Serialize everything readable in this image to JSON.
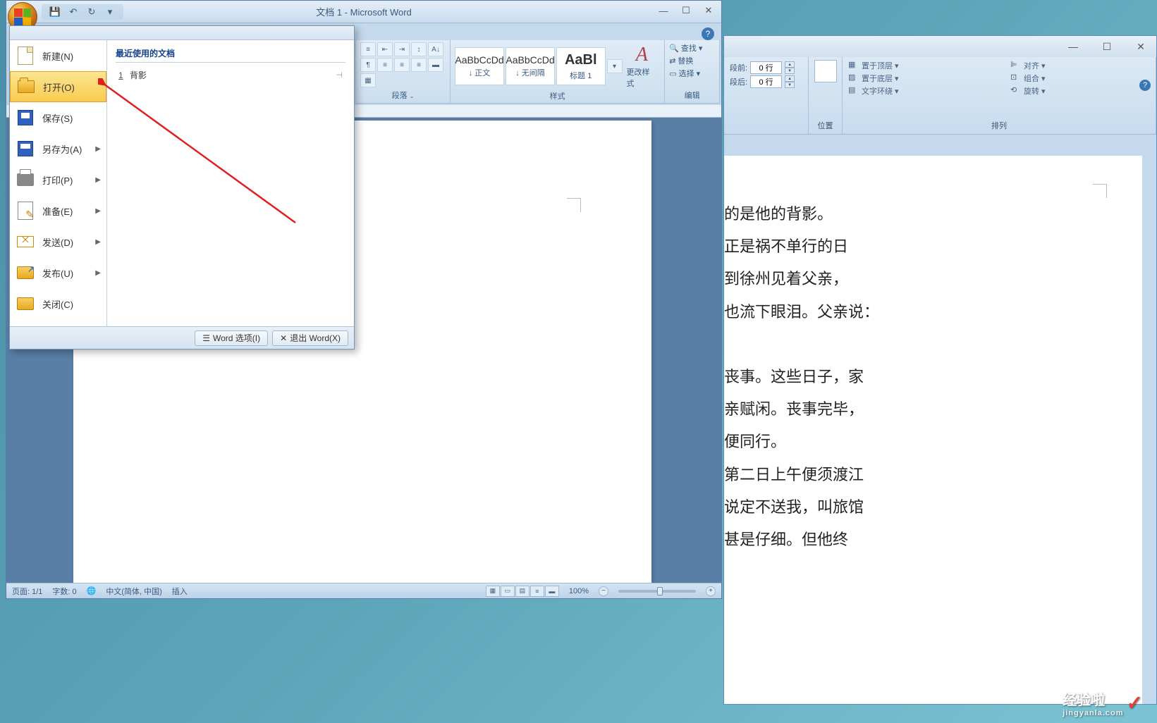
{
  "front_window": {
    "title": "文档 1 - Microsoft Word",
    "qat": {
      "save": "💾",
      "undo": "↶",
      "redo": "↻",
      "more": "▾"
    },
    "win": {
      "min": "—",
      "max": "☐",
      "close": "✕"
    },
    "help": "?"
  },
  "office_menu": {
    "items": {
      "new": "新建(N)",
      "open": "打开(O)",
      "save": "保存(S)",
      "saveas": "另存为(A)",
      "print": "打印(P)",
      "prepare": "准备(E)",
      "send": "发送(D)",
      "publish": "发布(U)",
      "close": "关闭(C)"
    },
    "recent_title": "最近使用的文档",
    "recent": [
      {
        "num": "1",
        "name": "背影"
      }
    ],
    "pin": "⊣",
    "bottom": {
      "options": "Word 选项(I)",
      "exit": "退出 Word(X)",
      "opt_icon": "☰",
      "exit_icon": "✕"
    }
  },
  "ribbon": {
    "paragraph": {
      "label": "段落",
      "drop": "⌄"
    },
    "styles": {
      "label": "样式",
      "normal_sample": "AaBbCcDd",
      "normal": "↓ 正文",
      "nospace_sample": "AaBbCcDd",
      "nospace": "↓ 无间隔",
      "heading_sample": "AaBl",
      "heading": "标题 1",
      "change": "更改样式",
      "change_icon": "A",
      "more": "▾"
    },
    "editing": {
      "label": "编辑",
      "find": "查找",
      "find_icon": "🔍",
      "replace": "替换",
      "replace_icon": "⇄",
      "select": "选择",
      "select_icon": "▭"
    }
  },
  "status": {
    "page": "页面: 1/1",
    "words": "字数: 0",
    "lang_icon": "🌐",
    "lang": "中文(简体, 中国)",
    "mode": "插入",
    "zoom": "100%",
    "minus": "−",
    "plus": "+"
  },
  "bg_window": {
    "win": {
      "min": "—",
      "max": "☐",
      "close": "✕"
    },
    "help": "?",
    "spacing": {
      "before_label": "段前:",
      "before_val": "0 行",
      "after_label": "段后:",
      "after_val": "0 行"
    },
    "pos_label": "位置",
    "arrange": {
      "label": "排列",
      "top": "置于顶层",
      "bottom": "置于底层",
      "wrap": "文字环绕",
      "align": "对齐",
      "group": "组合",
      "rotate": "旋转"
    },
    "doc_lines": [
      "的是他的背影。",
      "     正是祸不单行的日",
      "到徐州见着父亲，",
      "也流下眼泪。父亲说：",
      "",
      "丧事。这些日子，家",
      "亲赋闲。丧事完毕，",
      "便同行。",
      "第二日上午便须渡江",
      "说定不送我，叫旅馆",
      "甚是仔细。但他终"
    ]
  },
  "watermark": {
    "text": "经验啦",
    "sub": "jingyanla.com",
    "check": "✓"
  }
}
